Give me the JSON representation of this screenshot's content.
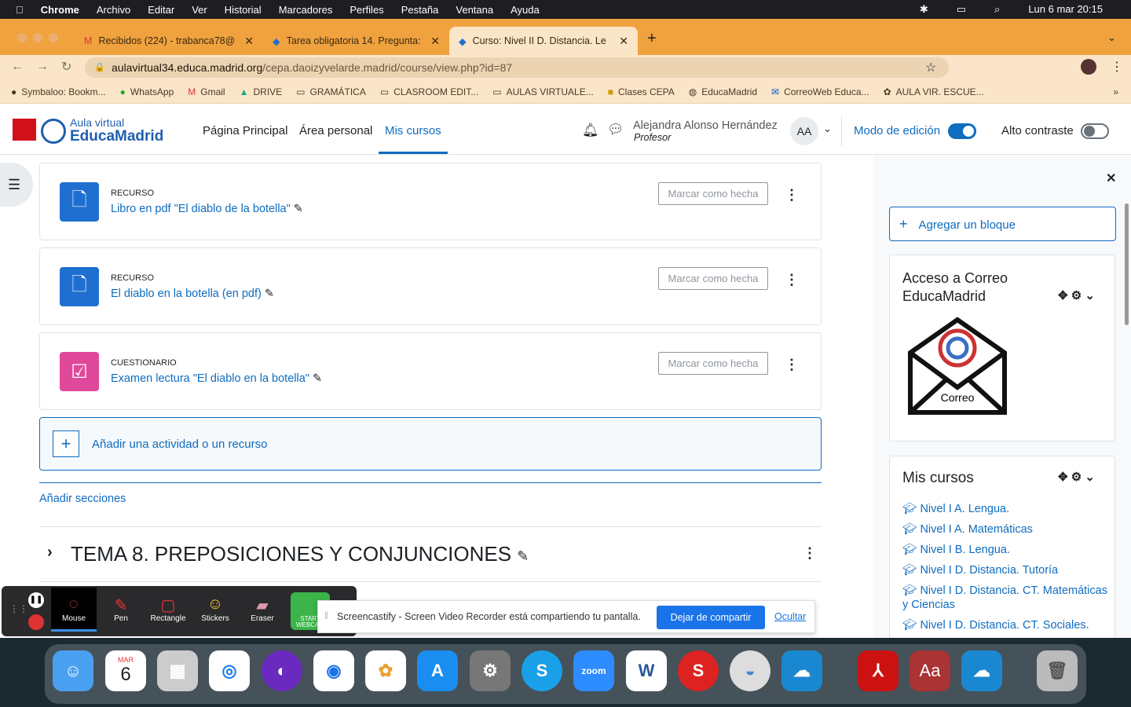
{
  "menubar": {
    "items": [
      "Chrome",
      "Archivo",
      "Editar",
      "Ver",
      "Historial",
      "Marcadores",
      "Perfiles",
      "Pestaña",
      "Ventana",
      "Ayuda"
    ],
    "clock": "Lun 6 mar  20:15"
  },
  "tabs": [
    {
      "label": "Recibidos (224) - trabanca78@",
      "icon": "gmail-icon"
    },
    {
      "label": "Tarea obligatoria 14. Pregunta:",
      "icon": "moodle-icon"
    },
    {
      "label": "Curso: Nivel II D. Distancia. Le",
      "icon": "moodle-icon",
      "active": true
    }
  ],
  "address": {
    "domain": "aulavirtual34.educa.madrid.org",
    "path": "/cepa.daoizyvelarde.madrid/course/view.php?id=87"
  },
  "bookmarks": [
    "Symbaloo: Bookm...",
    "WhatsApp",
    "Gmail",
    "DRIVE",
    "GRAMÁTICA",
    "CLASROOM EDIT...",
    "AULAS VIRTUALE...",
    "Clases CEPA",
    "EducaMadrid",
    "CorreoWeb Educa...",
    "AULA VIR. ESCUE..."
  ],
  "header": {
    "logo_top": "Aula virtual",
    "logo_bottom": "EducaMadrid",
    "nav": [
      "Página Principal",
      "Área personal",
      "Mis cursos"
    ],
    "user_name": "Alejandra Alonso Hernández",
    "user_role": "Profesor",
    "avatar": "AA",
    "edit_mode": "Modo de edición",
    "edit_mode_on": true,
    "contrast": "Alto contraste",
    "contrast_on": false
  },
  "activities": [
    {
      "type": "Recurso",
      "name": "Libro en pdf \"El diablo de la botella\"",
      "icon": "file-icon",
      "color": "#1f6fd0",
      "mark": "Marcar como hecha"
    },
    {
      "type": "Recurso",
      "name": "El diablo en la botella (en pdf)",
      "icon": "file-icon",
      "color": "#1f6fd0",
      "mark": "Marcar como hecha"
    },
    {
      "type": "Cuestionario",
      "name": "Examen lectura \"El diablo en la botella\"",
      "icon": "quiz-icon",
      "color": "#e0489b",
      "mark": "Marcar como hecha"
    }
  ],
  "add_activity": "Añadir una actividad o un recurso",
  "add_sections": "Añadir secciones",
  "section_title": "TEMA 8. PREPOSICIONES Y CONJUNCIONES",
  "drawer": {
    "add_block": "Agregar un bloque",
    "mail_block_title": "Acceso a Correo EducaMadrid",
    "mail_logo_text": "Correo",
    "courses_title": "Mis cursos",
    "courses": [
      "Nivel I A. Lengua.",
      "Nivel I A. Matemáticas",
      "Nivel I B. Lengua.",
      "Nivel I D. Distancia. Tutoría",
      "Nivel I D. Distancia. CT. Matemáticas y Ciencias",
      "Nivel I D. Distancia. CT. Sociales."
    ]
  },
  "annotation_tools": [
    "Mouse",
    "Pen",
    "Rectangle",
    "Stickers",
    "Eraser"
  ],
  "webcam": "START WEBCAM",
  "share_bar": {
    "message": "Screencastify - Screen Video Recorder está compartiendo tu pantalla.",
    "stop": "Dejar de compartir",
    "hide": "Ocultar"
  },
  "dock": {
    "calendar_month": "MAR",
    "calendar_day": "6",
    "apps": [
      "finder",
      "calendar",
      "launchpad",
      "safari",
      "firefox",
      "chrome",
      "photos",
      "app-store",
      "system-settings",
      "skype",
      "zoom",
      "word",
      "app",
      "screenshot",
      "cloud",
      "acrobat",
      "dictionary",
      "cloud",
      "trash"
    ]
  }
}
